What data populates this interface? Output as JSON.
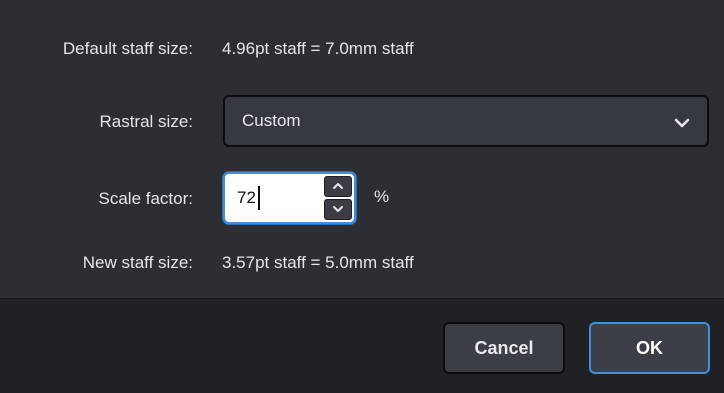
{
  "dialog": {
    "default_staff_size": {
      "label": "Default staff size:",
      "value": "4.96pt staff = 7.0mm staff"
    },
    "rastral_size": {
      "label": "Rastral size:",
      "selected": "Custom",
      "icon": "chevron-down-icon"
    },
    "scale_factor": {
      "label": "Scale factor:",
      "value": "72",
      "unit": "%",
      "icons": [
        "chevron-up-icon",
        "chevron-down-icon"
      ]
    },
    "new_staff_size": {
      "label": "New staff size:",
      "value": "3.57pt staff = 5.0mm staff"
    }
  },
  "footer": {
    "cancel_label": "Cancel",
    "ok_label": "OK"
  },
  "colors": {
    "background": "#2c2e33",
    "footer": "#1f2124",
    "accent": "#3e8fe0",
    "control": "#363940"
  }
}
